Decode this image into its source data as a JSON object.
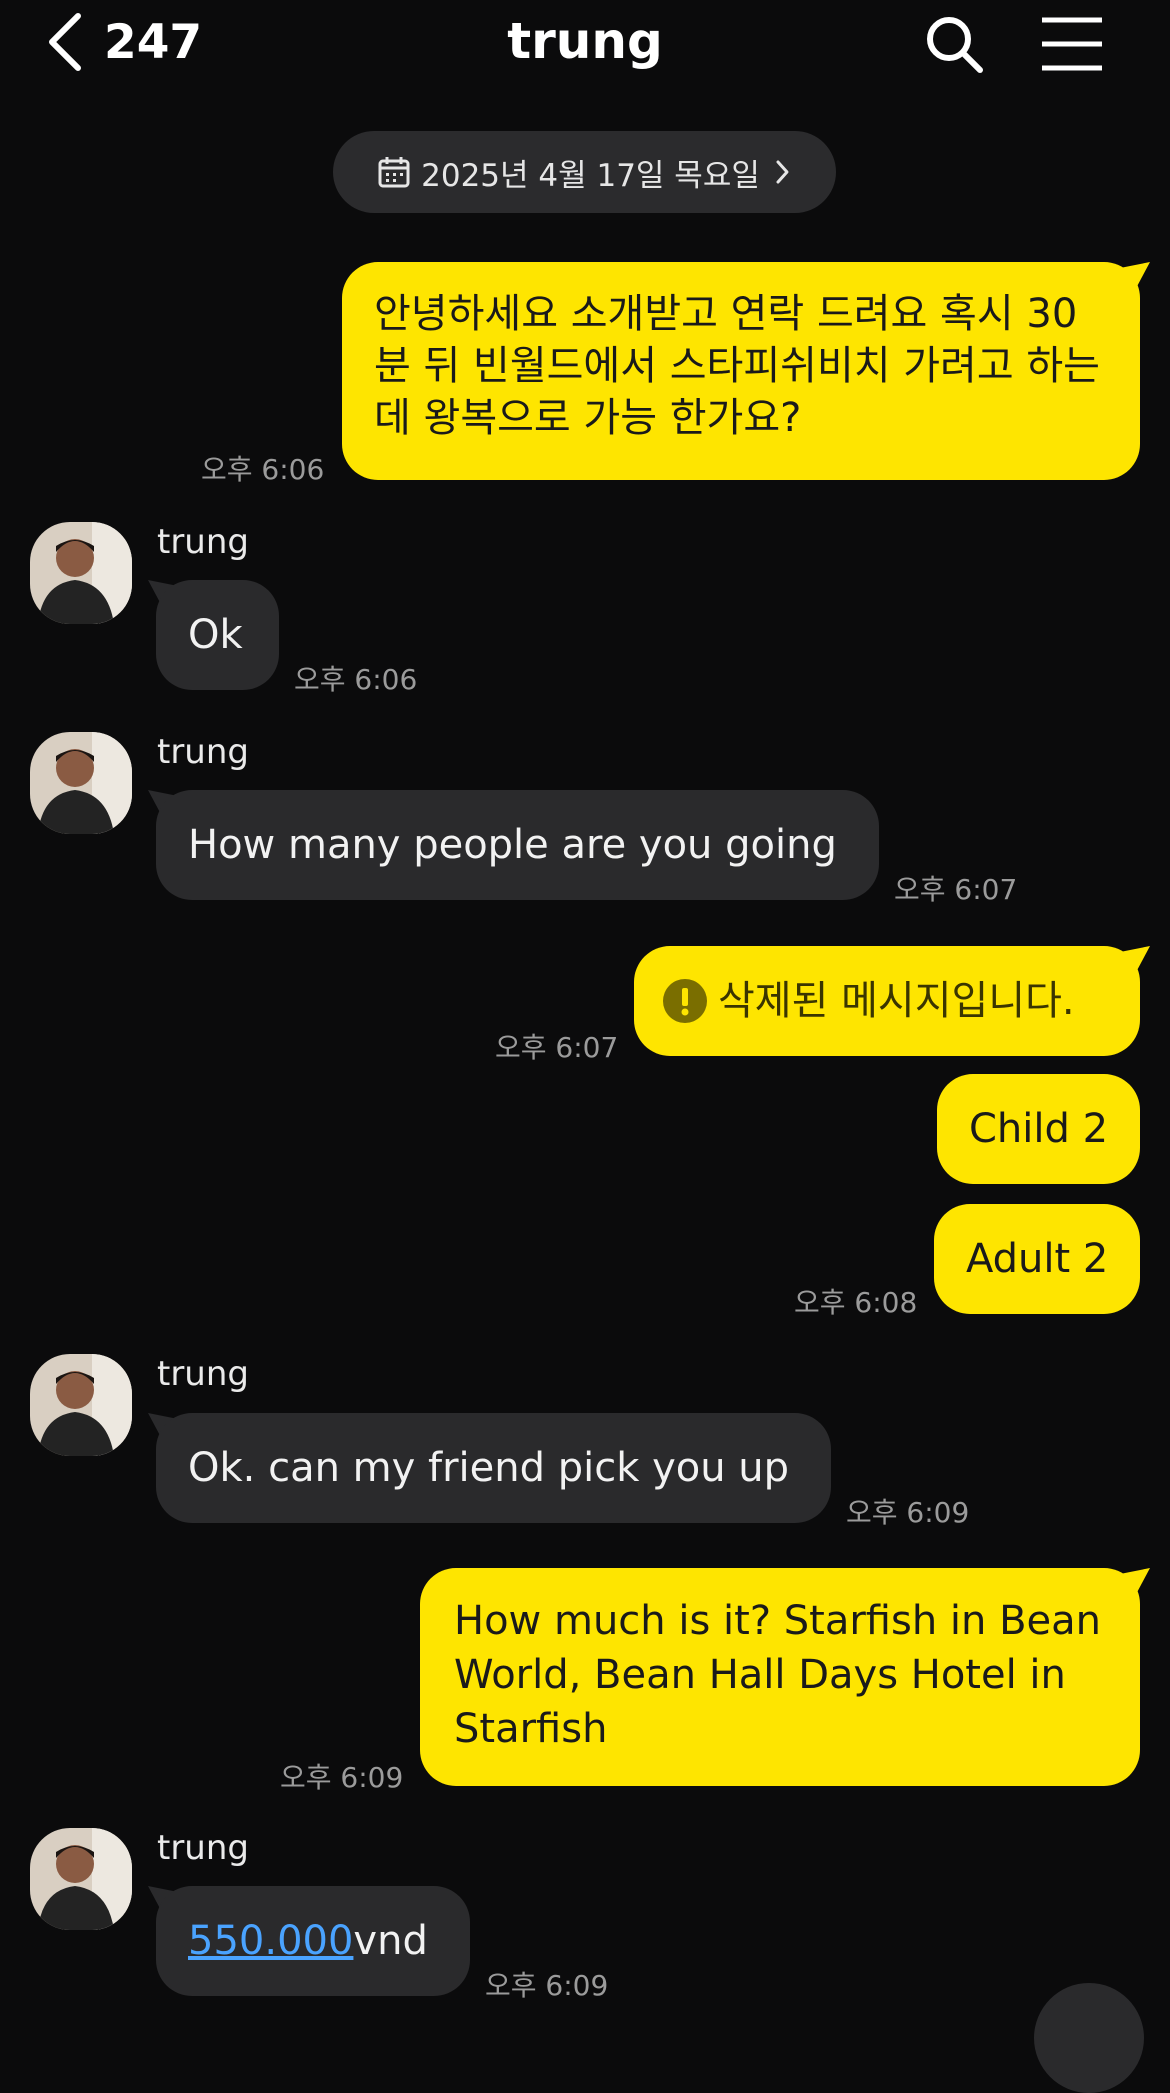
{
  "header": {
    "back_count": "247",
    "title": "trung"
  },
  "date_divider": "2025년 4월 17일 목요일",
  "messages": [
    {
      "side": "mine",
      "text": "안녕하세요 소개받고 연락 드려요 혹시 30 분 뒤 빈월드에서 스타피쉬비치 가려고 하는데 왕복으로 가능 한가요?",
      "time": "오후 6:06"
    },
    {
      "side": "theirs",
      "sender": "trung",
      "text": "Ok",
      "time": "오후 6:06"
    },
    {
      "side": "theirs",
      "sender": "trung",
      "text": "How many people are you going",
      "time": "오후 6:07"
    },
    {
      "side": "mine",
      "text": "삭제된 메시지입니다.",
      "time": "오후 6:07",
      "deleted": true
    },
    {
      "side": "mine",
      "text": "Child 2"
    },
    {
      "side": "mine",
      "text": "Adult 2",
      "time": "오후 6:08"
    },
    {
      "side": "theirs",
      "sender": "trung",
      "text": "Ok. can my friend pick you up",
      "time": "오후 6:09"
    },
    {
      "side": "mine",
      "text": "How much is it? Starfish in Bean World, Bean Hall Days Hotel in Starfish",
      "time": "오후 6:09"
    },
    {
      "side": "theirs",
      "sender": "trung",
      "link": "550.000",
      "text": "vnd",
      "time": "오후 6:09"
    }
  ],
  "colors": {
    "background": "#0b0b0c",
    "my_bubble": "#fee500",
    "their_bubble": "#2a2a2c",
    "link": "#4aa3ff",
    "timestamp": "#9b9b9b"
  },
  "icons": [
    "chevron-left-icon",
    "search-icon",
    "menu-icon",
    "calendar-icon",
    "chevron-right-icon",
    "exclamation-icon"
  ]
}
